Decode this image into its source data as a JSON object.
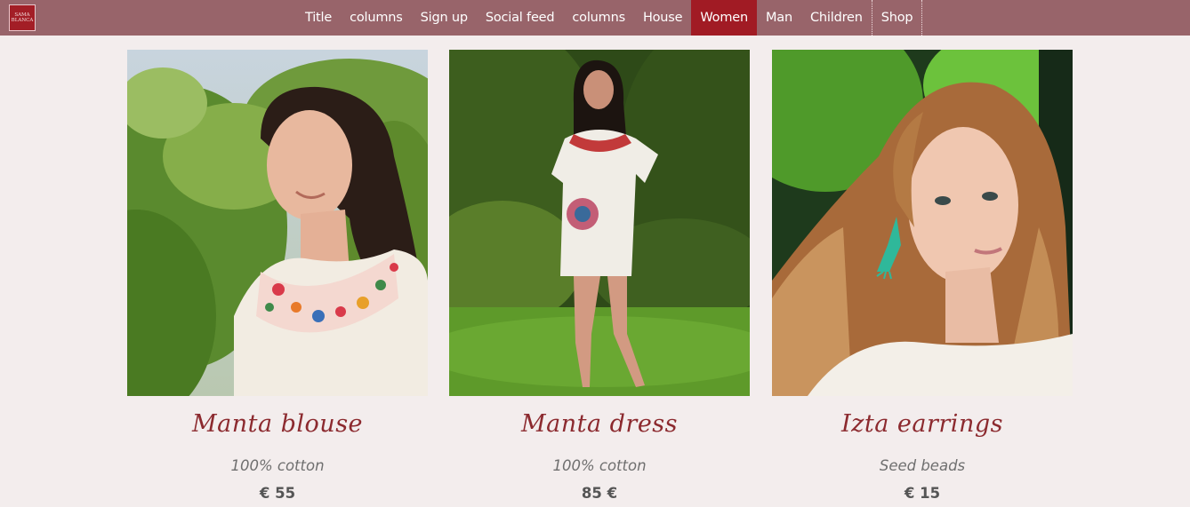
{
  "logo": {
    "text": "SAMA BLANCA"
  },
  "nav": {
    "items": [
      "Title",
      "columns",
      "Sign up",
      "Social feed",
      "columns",
      "House",
      "Women",
      "Man",
      "Children",
      "Shop"
    ],
    "active_index": 6
  },
  "products": [
    {
      "name": "Manta blouse",
      "material": "100% cotton",
      "price": "€ 55"
    },
    {
      "name": "Manta dress",
      "material": "100% cotton",
      "price": "85 €"
    },
    {
      "name": "Izta earrings",
      "material": "Seed beads",
      "price": "€ 15"
    }
  ],
  "colors": {
    "navbar": "#98646a",
    "active_tab": "#a11b24",
    "background": "#f3eded",
    "title": "#8c2a2f"
  }
}
